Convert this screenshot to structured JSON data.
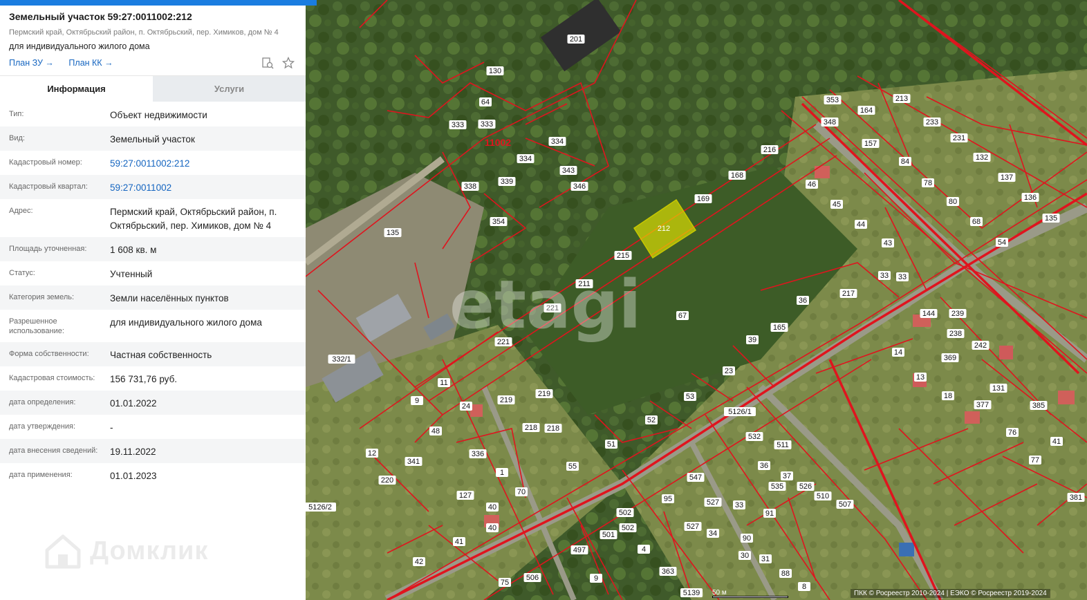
{
  "header": {
    "title": "Земельный участок 59:27:0011002:212",
    "address": "Пермский край, Октябрьский район, п. Октябрьский, пер. Химиков, дом № 4",
    "use": "для индивидуального жилого дома",
    "link_zu": "План ЗУ →",
    "link_kk": "План КК →"
  },
  "tabs": {
    "info": "Информация",
    "services": "Услуги"
  },
  "rows": [
    {
      "label": "Тип:",
      "value": "Объект недвижимости"
    },
    {
      "label": "Вид:",
      "value": "Земельный участок"
    },
    {
      "label": "Кадастровый номер:",
      "value": "59:27:0011002:212"
    },
    {
      "label": "Кадастровый квартал:",
      "value": "59:27:0011002"
    },
    {
      "label": "Адрес:",
      "value": "Пермский край, Октябрьский район, п. Октябрьский, пер. Химиков, дом № 4"
    },
    {
      "label": "Площадь уточненная:",
      "value": "1 608 кв. м"
    },
    {
      "label": "Статус:",
      "value": "Учтенный"
    },
    {
      "label": "Категория земель:",
      "value": "Земли населённых пунктов"
    },
    {
      "label": "Разрешенное использование:",
      "value": "для индивидуального жилого дома"
    },
    {
      "label": "Форма собственности:",
      "value": "Частная собственность"
    },
    {
      "label": "Кадастровая стоимость:",
      "value": "156 731,76 руб."
    },
    {
      "label": "дата определения:",
      "value": "01.01.2022"
    },
    {
      "label": "дата утверждения:",
      "value": "-"
    },
    {
      "label": "дата внесения сведений:",
      "value": "19.11.2022"
    },
    {
      "label": "дата применения:",
      "value": "01.01.2023"
    }
  ],
  "watermark": "Домклик",
  "map": {
    "selected_parcel": "212",
    "quarter_label": "11002",
    "etagi": "etagi",
    "scale": "50 м",
    "footer": "ПКК © Росреестр 2010-2024 | ЕЭКО © Росреестр 2019-2024",
    "parcel_labels": [
      "201",
      "130",
      "64",
      "333",
      "333",
      "11002",
      "334",
      "334",
      "343",
      "346",
      "339",
      "338",
      "354",
      "135",
      "216",
      "168",
      "169",
      "215",
      "211",
      "221",
      "221",
      "67",
      "217",
      "36",
      "33",
      "33",
      "43",
      "44",
      "45",
      "46",
      "157",
      "84",
      "78",
      "80",
      "68",
      "54",
      "137",
      "136",
      "135",
      "132",
      "231",
      "233",
      "213",
      "164",
      "353",
      "348",
      "39",
      "165",
      "23",
      "53",
      "52",
      "51",
      "55",
      "14",
      "13",
      "18",
      "238",
      "242",
      "239",
      "144",
      "369",
      "131",
      "377",
      "385",
      "76",
      "77",
      "41",
      "381",
      "332/1",
      "11",
      "9",
      "24",
      "48",
      "12",
      "341",
      "336",
      "219",
      "219",
      "218",
      "218",
      "220",
      "1",
      "70",
      "40",
      "40",
      "41",
      "42",
      "127",
      "5126/1",
      "5126/2",
      "532",
      "511",
      "36",
      "37",
      "535",
      "526",
      "510",
      "507",
      "547",
      "527",
      "527",
      "502",
      "502",
      "501",
      "497",
      "95",
      "34",
      "33",
      "91",
      "90",
      "30",
      "31",
      "88",
      "8",
      "9",
      "4",
      "363",
      "506",
      "75",
      "5139"
    ]
  }
}
